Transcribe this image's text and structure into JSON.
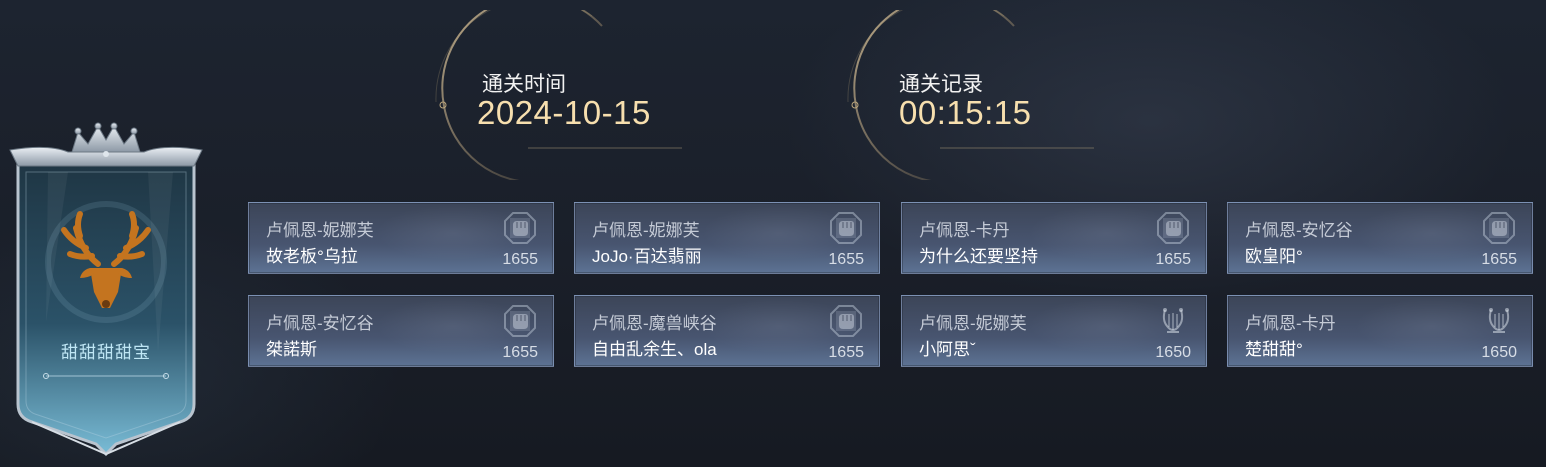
{
  "guild": {
    "name": "甜甜甜甜宝",
    "emblem": "deer-emblem-icon"
  },
  "stats": {
    "date_label": "通关时间",
    "date_value": "2024-10-15",
    "record_label": "通关记录",
    "record_value": "00:15:15"
  },
  "players": [
    {
      "guild": "卢佩恩-妮娜芙",
      "name": "故老板°乌拉",
      "score": "1655",
      "icon": "fist-badge-icon"
    },
    {
      "guild": "卢佩恩-妮娜芙",
      "name": "JoJo·百达翡丽",
      "score": "1655",
      "icon": "fist-badge-icon"
    },
    {
      "guild": "卢佩恩-卡丹",
      "name": "为什么还要坚持",
      "score": "1655",
      "icon": "fist-badge-icon"
    },
    {
      "guild": "卢佩恩-安忆谷",
      "name": "欧皇阳°",
      "score": "1655",
      "icon": "fist-badge-icon"
    },
    {
      "guild": "卢佩恩-安忆谷",
      "name": "桀諾斯",
      "score": "1655",
      "icon": "fist-badge-icon"
    },
    {
      "guild": "卢佩恩-魔兽峡谷",
      "name": "自由乱余生、ola",
      "score": "1655",
      "icon": "fist-badge-icon"
    },
    {
      "guild": "卢佩恩-妮娜芙",
      "name": "小阿思ˇ",
      "score": "1650",
      "icon": "lyre-icon"
    },
    {
      "guild": "卢佩恩-卡丹",
      "name": "楚甜甜°",
      "score": "1650",
      "icon": "lyre-icon"
    }
  ],
  "colors": {
    "value_gold": "#f7dfae",
    "crest_blue": "#6fb3cf",
    "deer_orange": "#c4741f"
  }
}
